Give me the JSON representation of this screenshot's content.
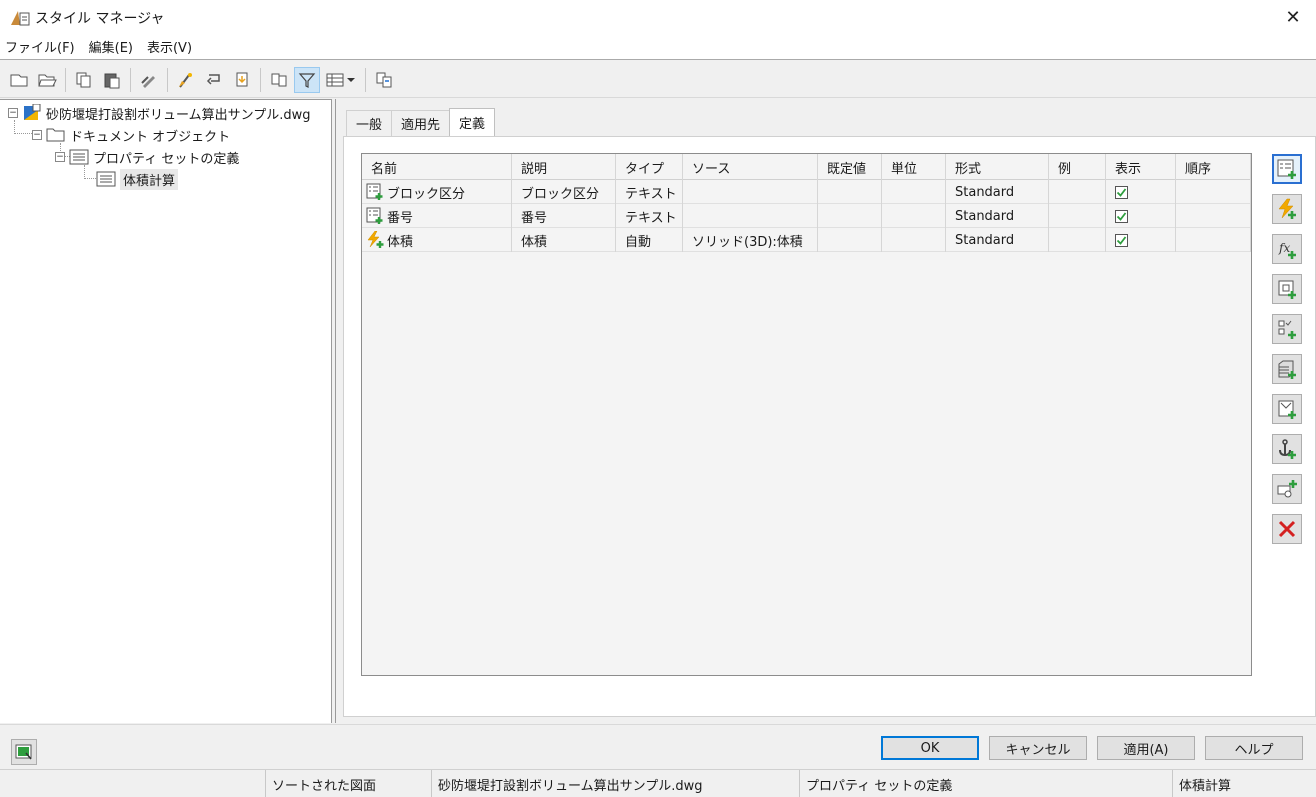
{
  "window": {
    "title": "スタイル マネージャ",
    "close_glyph": "✕"
  },
  "menu": [
    {
      "label": "ファイル(F)"
    },
    {
      "label": "編集(E)"
    },
    {
      "label": "表示(V)"
    }
  ],
  "toolbar": {
    "icons": [
      "new-icon",
      "open-icon",
      "copy-icon",
      "paste-icon",
      "edit-style-icon",
      "purge-icon",
      "toggle-view-icon",
      "set-from-icon",
      "compare-icon",
      "filter-icon",
      "view-mode-icon",
      "send-icon"
    ],
    "active": "filter-icon"
  },
  "tree": {
    "root": "砂防堰堤打設割ボリューム算出サンプル.dwg",
    "document_objects": "ドキュメント オブジェクト",
    "property_set_defs": "プロパティ セットの定義",
    "selected": "体積計算"
  },
  "tabs": [
    {
      "label": "一般",
      "active": false
    },
    {
      "label": "適用先",
      "active": false
    },
    {
      "label": "定義",
      "active": true
    }
  ],
  "grid": {
    "columns": [
      "名前",
      "説明",
      "タイプ",
      "ソース",
      "既定値",
      "単位",
      "形式",
      "例",
      "表示",
      "順序"
    ],
    "rows": [
      {
        "icon": "manual-property-icon",
        "name": "ブロック区分",
        "desc": "ブロック区分",
        "type": "テキスト",
        "source": "",
        "default": "",
        "unit": "",
        "format": "Standard",
        "example": "",
        "visible": true,
        "order": ""
      },
      {
        "icon": "manual-property-icon",
        "name": "番号",
        "desc": "番号",
        "type": "テキスト",
        "source": "",
        "default": "",
        "unit": "",
        "format": "Standard",
        "example": "",
        "visible": true,
        "order": ""
      },
      {
        "icon": "automatic-property-icon",
        "name": "体積",
        "desc": "体積",
        "type": "自動",
        "source": "ソリッド(3D):体積",
        "default": "",
        "unit": "",
        "format": "Standard",
        "example": "",
        "visible": true,
        "order": ""
      }
    ]
  },
  "side_tools": [
    "add-manual-property-icon",
    "add-automatic-property-icon",
    "add-formula-property-icon",
    "add-location-property-icon",
    "add-classification-property-icon",
    "add-material-property-icon",
    "add-project-property-icon",
    "add-anchor-property-icon",
    "add-graphic-property-icon",
    "delete-property-icon"
  ],
  "buttons": {
    "ok": "OK",
    "cancel": "キャンセル",
    "apply": "適用(A)",
    "help": "ヘルプ"
  },
  "status": {
    "sorted": "ソートされた図面",
    "file": "砂防堰堤打設割ボリューム算出サンプル.dwg",
    "category": "プロパティ セットの定義",
    "style": "体積計算"
  },
  "colors": {
    "accent": "#0078d7",
    "green": "#2e9e3e",
    "red": "#d42020",
    "lightning": "#f2a900"
  }
}
